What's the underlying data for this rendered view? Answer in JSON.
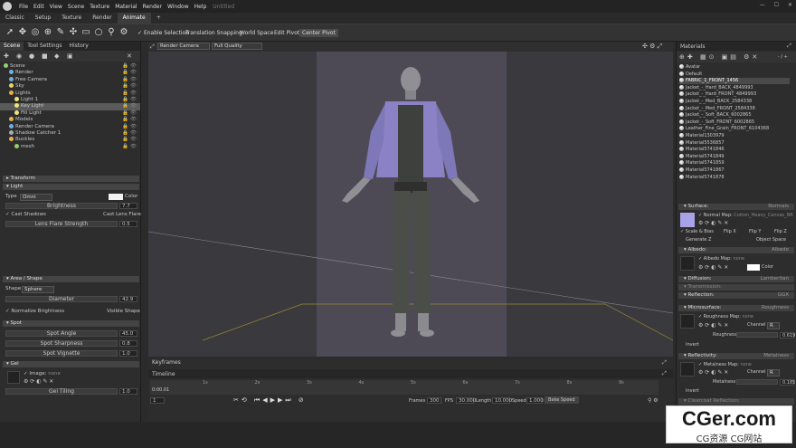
{
  "menubar": {
    "items": [
      "File",
      "Edit",
      "View",
      "Scene",
      "Texture",
      "Material",
      "Render",
      "Window",
      "Help"
    ],
    "doc_title": "Untitled"
  },
  "tabs": [
    "Classic",
    "Setup",
    "Texture",
    "Render",
    "Animate",
    "+"
  ],
  "toolbar": {
    "enable_selection": "Enable Selection",
    "translation_snapping": "Translation Snapping",
    "world_space": "World Space",
    "edit_pivot": "Edit Pivot",
    "center_pivot": "Center Pivot"
  },
  "viewport": {
    "camera": "Render Camera",
    "quality": "Full Quality"
  },
  "scene_tabs": [
    "Scene",
    "Tool Settings",
    "History"
  ],
  "scene_tree": [
    {
      "label": "Scene",
      "color": "#8fd16f",
      "indent": 0
    },
    {
      "label": "Render",
      "color": "#6fb0e0",
      "indent": 1
    },
    {
      "label": "Free Camera",
      "color": "#6fb0e0",
      "indent": 1
    },
    {
      "label": "Sky",
      "color": "#e6d36a",
      "indent": 1
    },
    {
      "label": "Lights",
      "color": "#e6b14a",
      "indent": 1
    },
    {
      "label": "Light 1",
      "color": "#f0e27a",
      "indent": 2
    },
    {
      "label": "Key Light",
      "color": "#f0e27a",
      "indent": 2
    },
    {
      "label": "Fill Light",
      "color": "#f0e27a",
      "indent": 2
    },
    {
      "label": "Models",
      "color": "#e6b14a",
      "indent": 1
    },
    {
      "label": "Render Camera",
      "color": "#6fb0e0",
      "indent": 1
    },
    {
      "label": "Shadow Catcher 1",
      "color": "#aaaaaa",
      "indent": 1
    },
    {
      "label": "Buckles",
      "color": "#e6b14a",
      "indent": 1
    },
    {
      "label": "mesh",
      "color": "#8fd16f",
      "indent": 2
    }
  ],
  "props": {
    "transform": "Transform",
    "light": "Light",
    "type_label": "Type",
    "type_value": "Omni",
    "color_label": "Color",
    "brightness_label": "Brightness",
    "brightness_value": "7.7",
    "cast_shadows": "Cast Shadows",
    "cast_lens_flare": "Cast Lens Flare",
    "lens_flare_strength": "Lens Flare Strength",
    "lens_flare_value": "0.5",
    "area_shape": "Area / Shape",
    "shape_label": "Shape",
    "shape_value": "Sphere",
    "diameter_label": "Diameter",
    "diameter_value": "42.9",
    "normalize_brightness": "Normalize Brightness",
    "visible_shape": "Visible Shape",
    "spot": "Spot",
    "spot_angle": "Spot Angle",
    "spot_angle_value": "45.0",
    "spot_sharpness": "Spot Sharpness",
    "spot_sharpness_value": "0.8",
    "spot_vignette": "Spot Vignette",
    "spot_vignette_value": "1.0",
    "gel": "Gel",
    "image_label": "Image:",
    "image_value": "none",
    "gel_tiling": "Gel Tiling",
    "gel_tiling_value": "1.0"
  },
  "timeline": {
    "keyframes": "Keyframes",
    "timeline": "Timeline",
    "time": "0:00.01",
    "frame": "1",
    "ticks": [
      "1s",
      "2s",
      "3s",
      "4s",
      "5s",
      "6s",
      "7s",
      "8s",
      "9s"
    ],
    "frames_label": "Frames",
    "frames_value": "300",
    "fps_label": "FPS",
    "fps_value": "30.000",
    "length_label": "Length",
    "length_value": "10.000",
    "speed_label": "Speed",
    "speed_value": "1.000",
    "bake_speed": "Bake Speed"
  },
  "materials": {
    "title": "Materials",
    "search": "- / +",
    "list": [
      "Avatar",
      "Default",
      "FABRIC_1_FRONT_1456",
      "Jacket_-_Hard_BACK_4849993",
      "Jacket_-_Hard_FRONT_4849993",
      "Jacket_-_Med_BACK_2584338",
      "Jacket_-_Med_FRONT_2584338",
      "Jacket_-_Soft_BACK_6002865",
      "Jacket_-_Soft_FRONT_6002865",
      "Leather_Fine_Grain_FRONT_6104368",
      "Material1303979",
      "Material5536857",
      "Material5741846",
      "Material5741849",
      "Material5741859",
      "Material5741867",
      "Material5741878"
    ],
    "selected_index": 2,
    "surface": "Surface:",
    "surface_value": "Normals",
    "normal_map": "Normal Map:",
    "normal_map_value": "Cotton_Heavy_Canvas_NR",
    "scale_bias": "Scale & Bias",
    "flip_x": "Flip X",
    "flip_y": "Flip Y",
    "flip_z": "Flip Z",
    "generate_z": "Generate Z",
    "object_space": "Object Space",
    "albedo": "Albedo:",
    "albedo_value": "Albedo",
    "albedo_map": "Albedo Map:",
    "albedo_map_value": "none",
    "color": "Color",
    "diffusion": "Diffusion:",
    "diffusion_value": "Lambertian",
    "transmission": "Transmission:",
    "reflection": "Reflection:",
    "reflection_value": "GGX",
    "microsurface": "Microsurface:",
    "microsurface_value": "Roughness",
    "roughness_map": "Roughness Map:",
    "roughness_map_value": "none",
    "channel": "Channel",
    "channel_value": "R",
    "roughness": "Roughness",
    "roughness_value": "0.619",
    "invert": "Invert",
    "reflectivity": "Reflectivity:",
    "reflectivity_value": "Metalness",
    "metalness_map": "Metalness Map:",
    "metalness_map_value": "none",
    "metalness": "Metalness",
    "metalness_value": "0.185",
    "clearcoat": "Clearcoat Reflection:"
  },
  "watermark": {
    "brand": "CGer.com",
    "sub": "CG资源 CG网站"
  },
  "colors": {
    "backdrop": "#4d4a55",
    "jacket": "#8a82c4",
    "pants": "#4a4d48",
    "accent": "#5aa0e8"
  }
}
